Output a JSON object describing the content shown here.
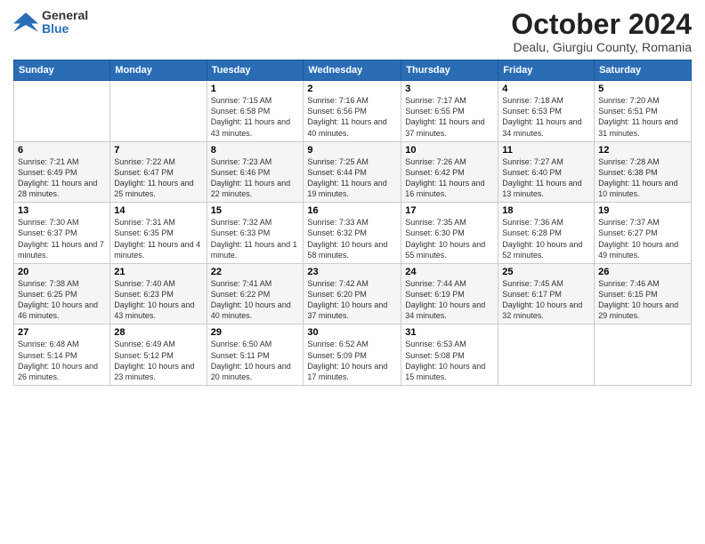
{
  "header": {
    "logo_general": "General",
    "logo_blue": "Blue",
    "month": "October 2024",
    "location": "Dealu, Giurgiu County, Romania"
  },
  "days_of_week": [
    "Sunday",
    "Monday",
    "Tuesday",
    "Wednesday",
    "Thursday",
    "Friday",
    "Saturday"
  ],
  "weeks": [
    [
      {
        "day": "",
        "info": ""
      },
      {
        "day": "",
        "info": ""
      },
      {
        "day": "1",
        "info": "Sunrise: 7:15 AM\nSunset: 6:58 PM\nDaylight: 11 hours and 43 minutes."
      },
      {
        "day": "2",
        "info": "Sunrise: 7:16 AM\nSunset: 6:56 PM\nDaylight: 11 hours and 40 minutes."
      },
      {
        "day": "3",
        "info": "Sunrise: 7:17 AM\nSunset: 6:55 PM\nDaylight: 11 hours and 37 minutes."
      },
      {
        "day": "4",
        "info": "Sunrise: 7:18 AM\nSunset: 6:53 PM\nDaylight: 11 hours and 34 minutes."
      },
      {
        "day": "5",
        "info": "Sunrise: 7:20 AM\nSunset: 6:51 PM\nDaylight: 11 hours and 31 minutes."
      }
    ],
    [
      {
        "day": "6",
        "info": "Sunrise: 7:21 AM\nSunset: 6:49 PM\nDaylight: 11 hours and 28 minutes."
      },
      {
        "day": "7",
        "info": "Sunrise: 7:22 AM\nSunset: 6:47 PM\nDaylight: 11 hours and 25 minutes."
      },
      {
        "day": "8",
        "info": "Sunrise: 7:23 AM\nSunset: 6:46 PM\nDaylight: 11 hours and 22 minutes."
      },
      {
        "day": "9",
        "info": "Sunrise: 7:25 AM\nSunset: 6:44 PM\nDaylight: 11 hours and 19 minutes."
      },
      {
        "day": "10",
        "info": "Sunrise: 7:26 AM\nSunset: 6:42 PM\nDaylight: 11 hours and 16 minutes."
      },
      {
        "day": "11",
        "info": "Sunrise: 7:27 AM\nSunset: 6:40 PM\nDaylight: 11 hours and 13 minutes."
      },
      {
        "day": "12",
        "info": "Sunrise: 7:28 AM\nSunset: 6:38 PM\nDaylight: 11 hours and 10 minutes."
      }
    ],
    [
      {
        "day": "13",
        "info": "Sunrise: 7:30 AM\nSunset: 6:37 PM\nDaylight: 11 hours and 7 minutes."
      },
      {
        "day": "14",
        "info": "Sunrise: 7:31 AM\nSunset: 6:35 PM\nDaylight: 11 hours and 4 minutes."
      },
      {
        "day": "15",
        "info": "Sunrise: 7:32 AM\nSunset: 6:33 PM\nDaylight: 11 hours and 1 minute."
      },
      {
        "day": "16",
        "info": "Sunrise: 7:33 AM\nSunset: 6:32 PM\nDaylight: 10 hours and 58 minutes."
      },
      {
        "day": "17",
        "info": "Sunrise: 7:35 AM\nSunset: 6:30 PM\nDaylight: 10 hours and 55 minutes."
      },
      {
        "day": "18",
        "info": "Sunrise: 7:36 AM\nSunset: 6:28 PM\nDaylight: 10 hours and 52 minutes."
      },
      {
        "day": "19",
        "info": "Sunrise: 7:37 AM\nSunset: 6:27 PM\nDaylight: 10 hours and 49 minutes."
      }
    ],
    [
      {
        "day": "20",
        "info": "Sunrise: 7:38 AM\nSunset: 6:25 PM\nDaylight: 10 hours and 46 minutes."
      },
      {
        "day": "21",
        "info": "Sunrise: 7:40 AM\nSunset: 6:23 PM\nDaylight: 10 hours and 43 minutes."
      },
      {
        "day": "22",
        "info": "Sunrise: 7:41 AM\nSunset: 6:22 PM\nDaylight: 10 hours and 40 minutes."
      },
      {
        "day": "23",
        "info": "Sunrise: 7:42 AM\nSunset: 6:20 PM\nDaylight: 10 hours and 37 minutes."
      },
      {
        "day": "24",
        "info": "Sunrise: 7:44 AM\nSunset: 6:19 PM\nDaylight: 10 hours and 34 minutes."
      },
      {
        "day": "25",
        "info": "Sunrise: 7:45 AM\nSunset: 6:17 PM\nDaylight: 10 hours and 32 minutes."
      },
      {
        "day": "26",
        "info": "Sunrise: 7:46 AM\nSunset: 6:15 PM\nDaylight: 10 hours and 29 minutes."
      }
    ],
    [
      {
        "day": "27",
        "info": "Sunrise: 6:48 AM\nSunset: 5:14 PM\nDaylight: 10 hours and 26 minutes."
      },
      {
        "day": "28",
        "info": "Sunrise: 6:49 AM\nSunset: 5:12 PM\nDaylight: 10 hours and 23 minutes."
      },
      {
        "day": "29",
        "info": "Sunrise: 6:50 AM\nSunset: 5:11 PM\nDaylight: 10 hours and 20 minutes."
      },
      {
        "day": "30",
        "info": "Sunrise: 6:52 AM\nSunset: 5:09 PM\nDaylight: 10 hours and 17 minutes."
      },
      {
        "day": "31",
        "info": "Sunrise: 6:53 AM\nSunset: 5:08 PM\nDaylight: 10 hours and 15 minutes."
      },
      {
        "day": "",
        "info": ""
      },
      {
        "day": "",
        "info": ""
      }
    ]
  ]
}
